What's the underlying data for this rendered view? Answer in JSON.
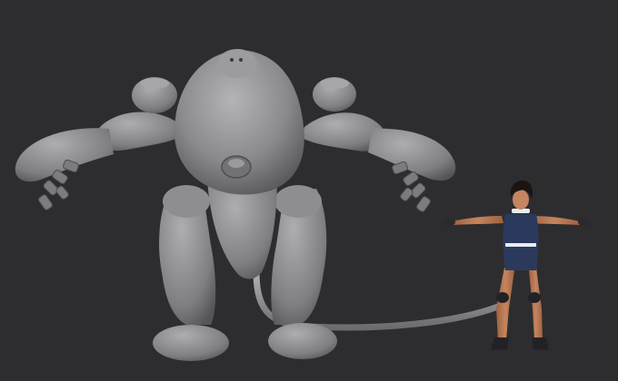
{
  "scene": {
    "background_color": "#2d2d2f",
    "mech_color": "#8a8a8c",
    "mech_shade": "#5e5e60",
    "mech_highlight": "#b4b4b6",
    "hose_color": "#9a9a9c",
    "character": {
      "skin_color": "#b9784f",
      "suit_color": "#2b3a5c",
      "glove_color": "#2a2a2e",
      "hair_color": "#1a1512",
      "band_color": "#e9edf0"
    }
  }
}
